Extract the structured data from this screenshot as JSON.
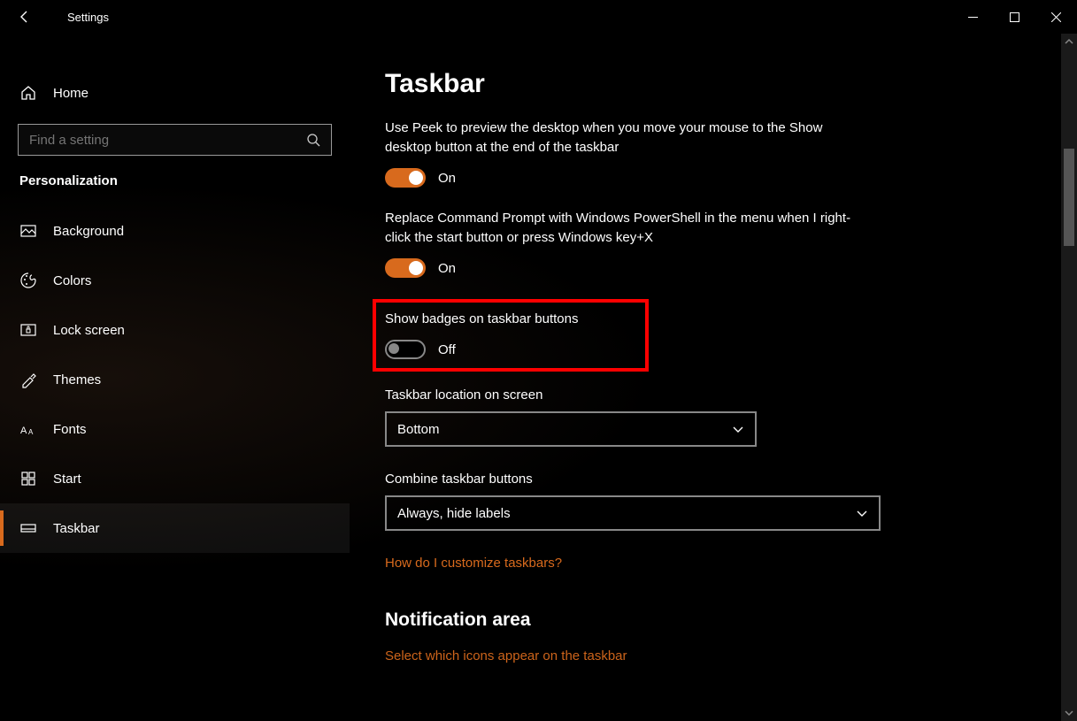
{
  "titlebar": {
    "app_title": "Settings"
  },
  "sidebar": {
    "home_label": "Home",
    "search_placeholder": "Find a setting",
    "category_label": "Personalization",
    "items": [
      {
        "label": "Background"
      },
      {
        "label": "Colors"
      },
      {
        "label": "Lock screen"
      },
      {
        "label": "Themes"
      },
      {
        "label": "Fonts"
      },
      {
        "label": "Start"
      },
      {
        "label": "Taskbar"
      }
    ]
  },
  "content": {
    "page_title": "Taskbar",
    "peek": {
      "desc": "Use Peek to preview the desktop when you move your mouse to the Show desktop button at the end of the taskbar",
      "state_label": "On"
    },
    "powershell": {
      "desc": "Replace Command Prompt with Windows PowerShell in the menu when I right-click the start button or press Windows key+X",
      "state_label": "On"
    },
    "badges": {
      "desc": "Show badges on taskbar buttons",
      "state_label": "Off"
    },
    "location": {
      "label": "Taskbar location on screen",
      "value": "Bottom"
    },
    "combine": {
      "label": "Combine taskbar buttons",
      "value": "Always, hide labels"
    },
    "help_link": "How do I customize taskbars?",
    "notification_header": "Notification area",
    "notification_link": "Select which icons appear on the taskbar"
  },
  "colors": {
    "accent": "#d86a1d"
  }
}
